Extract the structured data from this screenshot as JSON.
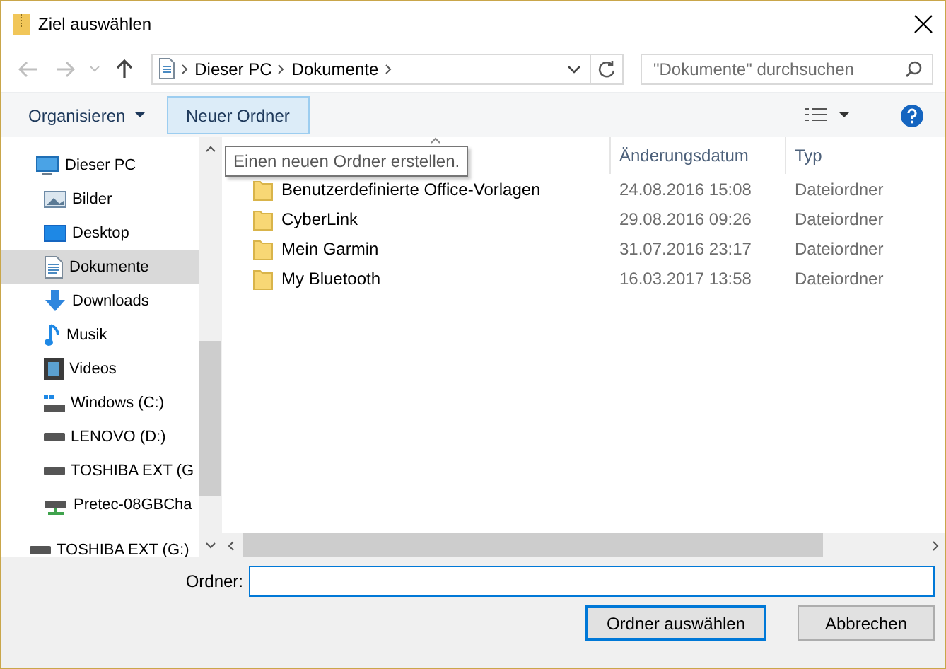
{
  "window": {
    "title": "Ziel auswählen"
  },
  "address": {
    "path": [
      "Dieser PC",
      "Dokumente"
    ]
  },
  "search": {
    "placeholder": "\"Dokumente\" durchsuchen"
  },
  "toolbar": {
    "organize": "Organisieren",
    "new_folder": "Neuer Ordner",
    "tooltip": "Einen neuen Ordner erstellen."
  },
  "sidebar": {
    "items": [
      {
        "label": "Dieser PC",
        "kind": "pc",
        "selected": false,
        "children": [
          {
            "label": "Bilder",
            "kind": "pictures",
            "selected": false
          },
          {
            "label": "Desktop",
            "kind": "desktop",
            "selected": false
          },
          {
            "label": "Dokumente",
            "kind": "documents",
            "selected": true
          },
          {
            "label": "Downloads",
            "kind": "downloads",
            "selected": false
          },
          {
            "label": "Musik",
            "kind": "music",
            "selected": false
          },
          {
            "label": "Videos",
            "kind": "videos",
            "selected": false
          },
          {
            "label": "Windows (C:)",
            "kind": "system-drive",
            "selected": false
          },
          {
            "label": "LENOVO (D:)",
            "kind": "drive",
            "selected": false
          },
          {
            "label": "TOSHIBA EXT (G",
            "kind": "drive",
            "selected": false
          },
          {
            "label": "Pretec-08GBCha",
            "kind": "network-drive",
            "selected": false
          }
        ]
      },
      {
        "label": "TOSHIBA EXT (G:)",
        "kind": "drive",
        "selected": false
      }
    ]
  },
  "table": {
    "columns": [
      "Änderungsdatum",
      "Typ"
    ],
    "rows": [
      {
        "name": "Benutzerdefinierte Office-Vorlagen",
        "date": "24.08.2016 15:08",
        "type": "Dateiordner"
      },
      {
        "name": "CyberLink",
        "date": "29.08.2016 09:26",
        "type": "Dateiordner"
      },
      {
        "name": "Mein Garmin",
        "date": "31.07.2016 23:17",
        "type": "Dateiordner"
      },
      {
        "name": "My Bluetooth",
        "date": "16.03.2017 13:58",
        "type": "Dateiordner"
      }
    ]
  },
  "footer": {
    "folder_label": "Ordner:",
    "buttons": [
      {
        "label": "Ordner auswählen",
        "default": true
      },
      {
        "label": "Abbrechen",
        "default": false
      }
    ]
  }
}
